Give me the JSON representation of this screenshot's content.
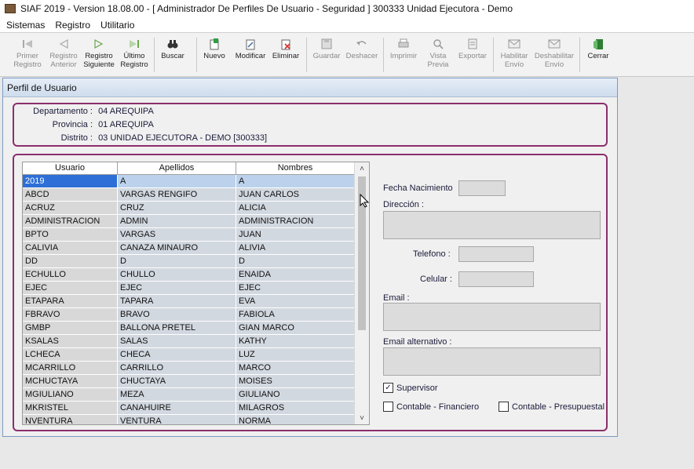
{
  "window_title": "SIAF 2019 - Version 18.08.00 - [ Administrador De Perfiles De Usuario - Seguridad ] 300333 Unidad Ejecutora - Demo",
  "menu": [
    "Sistemas",
    "Registro",
    "Utilitario"
  ],
  "toolbar": {
    "primer_registro": "Primer\nRegistro",
    "registro_anterior": "Registro\nAnterior",
    "registro_siguiente": "Registro\nSiguiente",
    "ultimo_registro": "Último\nRegistro",
    "buscar": "Buscar",
    "nuevo": "Nuevo",
    "modificar": "Modificar",
    "eliminar": "Eliminar",
    "guardar": "Guardar",
    "deshacer": "Deshacer",
    "imprimir": "Imprimir",
    "vista_previa": "Vista\nPrevia",
    "exportar": "Exportar",
    "habilitar_envio": "Habilitar\nEnvío",
    "deshabilitar_envio": "Deshabilitar\nEnvío",
    "cerrar": "Cerrar"
  },
  "panel_title": "Perfil de Usuario",
  "info": {
    "departamento_label": "Departamento :",
    "departamento_value": "04  AREQUIPA",
    "provincia_label": "Provincia :",
    "provincia_value": "01  AREQUIPA",
    "distrito_label": "Distrito :",
    "distrito_value": "03  UNIDAD EJECUTORA - DEMO [300333]"
  },
  "grid": {
    "headers": [
      "Usuario",
      "Apellidos",
      "Nombres"
    ],
    "rows": [
      [
        "2019",
        "A",
        "A"
      ],
      [
        "ABCD",
        "VARGAS RENGIFO",
        "JUAN CARLOS"
      ],
      [
        "ACRUZ",
        "CRUZ",
        "ALICIA"
      ],
      [
        "ADMINISTRACION",
        "ADMIN",
        "ADMINISTRACION"
      ],
      [
        "BPTO",
        "VARGAS",
        "JUAN"
      ],
      [
        "CALIVIA",
        "CANAZA MINAURO",
        "ALIVIA"
      ],
      [
        "DD",
        "D",
        "D"
      ],
      [
        "ECHULLO",
        "CHULLO",
        "ENAIDA"
      ],
      [
        "EJEC",
        "EJEC",
        "EJEC"
      ],
      [
        "ETAPARA",
        "TAPARA",
        "EVA"
      ],
      [
        "FBRAVO",
        "BRAVO",
        "FABIOLA"
      ],
      [
        "GMBP",
        "BALLONA PRETEL",
        "GIAN MARCO"
      ],
      [
        "KSALAS",
        "SALAS",
        "KATHY"
      ],
      [
        "LCHECA",
        "CHECA",
        "LUZ"
      ],
      [
        "MCARRILLO",
        "CARRILLO",
        "MARCO"
      ],
      [
        "MCHUCTAYA",
        "CHUCTAYA",
        "MOISES"
      ],
      [
        "MGIULIANO",
        "MEZA",
        "GIULIANO"
      ],
      [
        "MKRISTEL",
        "CANAHUIRE",
        "MILAGROS"
      ],
      [
        "NVENTURA",
        "VENTURA",
        "NORMA"
      ]
    ]
  },
  "form": {
    "fecha_nacimiento_label": "Fecha Nacimiento",
    "direccion_label": "Dirección :",
    "telefono_label": "Telefono :",
    "celular_label": "Celular :",
    "email_label": "Email :",
    "email_alternativo_label": "Email  alternativo :",
    "supervisor_label": "Supervisor",
    "supervisor_checked": true,
    "contable_financiero_label": "Contable - Financiero",
    "contable_financiero_checked": false,
    "contable_presupuestal_label": "Contable - Presupuestal",
    "contable_presupuestal_checked": false
  },
  "colors": {
    "panel_border": "#8b2f6b",
    "selection": "#2d6fd6",
    "row_background": "#d2d8e0"
  }
}
